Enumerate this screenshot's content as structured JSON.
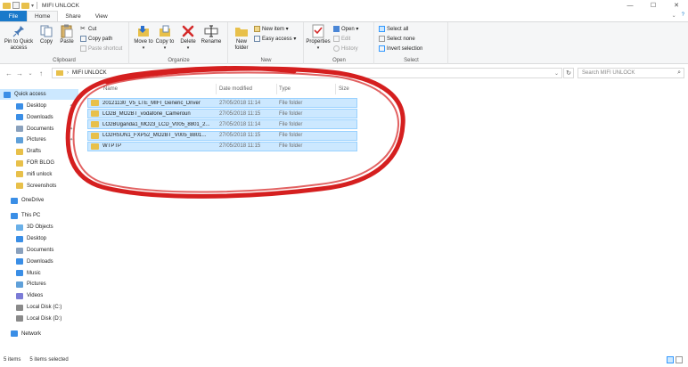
{
  "window": {
    "title": "MIFI UNLOCK",
    "controls": [
      "—",
      "☐",
      "✕"
    ]
  },
  "tabs": [
    "File",
    "Home",
    "Share",
    "View"
  ],
  "ribbon": {
    "clipboard": {
      "label": "Clipboard",
      "pin_to_quick_access": "Pin to Quick access",
      "copy": "Copy",
      "paste": "Paste",
      "cut": "Cut",
      "copy_path": "Copy path",
      "paste_shortcut": "Paste shortcut"
    },
    "organize": {
      "label": "Organize",
      "move_to": "Move to",
      "copy_to": "Copy to",
      "delete": "Delete",
      "rename": "Rename"
    },
    "new": {
      "label": "New",
      "new_folder": "New folder",
      "new_item": "New item ▾",
      "easy_access": "Easy access ▾"
    },
    "open": {
      "label": "Open",
      "properties": "Properties",
      "open": "Open ▾",
      "edit": "Edit",
      "history": "History"
    },
    "select": {
      "label": "Select",
      "select_all": "Select all",
      "select_none": "Select none",
      "invert_selection": "Invert selection"
    }
  },
  "address": {
    "path": "MIFI UNLOCK",
    "search_placeholder": "Search MIFI UNLOCK"
  },
  "nav": {
    "quick_access": "Quick access",
    "quick_items": [
      "Desktop",
      "Downloads",
      "Documents",
      "Pictures",
      "Drafts",
      "FOR BLOG",
      "mifi unlock",
      "Screenshots"
    ],
    "onedrive": "OneDrive",
    "this_pc": "This PC",
    "pc_items": [
      "3D Objects",
      "Desktop",
      "Documents",
      "Downloads",
      "Music",
      "Pictures",
      "Videos",
      "Local Disk (C:)",
      "Local Disk (D:)"
    ],
    "network": "Network"
  },
  "columns": {
    "name": "Name",
    "date": "Date modified",
    "type": "Type",
    "size": "Size"
  },
  "files": [
    {
      "name": "20121130_V5_LTE_MIFI_Generic_Driver",
      "date": "27/05/2018 11:14",
      "type": "File folder"
    },
    {
      "name": "LO2B_MO2BT_vodafone_Cameroun",
      "date": "27/05/2018 11:15",
      "type": "File folder"
    },
    {
      "name": "LO2BUganda1_MO23_LCD_V005_8801_2...",
      "date": "27/05/2018 11:14",
      "type": "File folder"
    },
    {
      "name": "LO2HSUN1_FXP52_MO2BT_V005_8801...",
      "date": "27/05/2018 11:15",
      "type": "File folder"
    },
    {
      "name": "WTPTP",
      "date": "27/05/2018 11:15",
      "type": "File folder"
    }
  ],
  "status": {
    "items": "5 items",
    "selected": "5 items selected"
  },
  "colors": {
    "accent": "#1979ca",
    "selection": "#cce8ff",
    "annotation": "#d51f1f",
    "folder": "#e8c04a"
  }
}
